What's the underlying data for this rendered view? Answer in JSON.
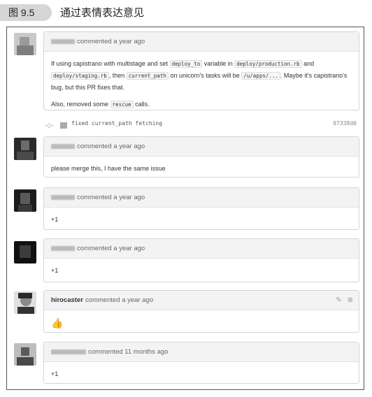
{
  "figure": {
    "number": "图 9.5",
    "title": "通过表情表达意见"
  },
  "comments": [
    {
      "author": "",
      "meta": "commented a year ago",
      "paragraphs": [
        [
          "If using capistrano with multistage and set ",
          "deploy_to",
          " variable in ",
          "deploy/production.rb",
          " and ",
          "deploy/staging.rb",
          ", then ",
          "current_path",
          " on unicorn's tasks will be ",
          "/u/apps/...",
          ". Maybe it's capistrano's bug, but this PR fixes that."
        ],
        [
          "Also, removed some ",
          "rescue",
          " calls."
        ]
      ]
    },
    {
      "author": "",
      "meta": "commented a year ago",
      "text": "please merge this, I have the same issue"
    },
    {
      "author": "",
      "meta": "commented a year ago",
      "text": "+1"
    },
    {
      "author": "",
      "meta": "commented a year ago",
      "text": "+1"
    },
    {
      "author": "hirocaster",
      "meta": "commented a year ago",
      "text": "👍"
    },
    {
      "author": "",
      "meta": "commented 11 months ago",
      "text": "+1"
    }
  ],
  "commit": {
    "message": "fixed current_path fetching",
    "sha": "07338d0"
  },
  "icons": {
    "edit": "pencil-icon",
    "delete": "close-circle-icon",
    "commit": "commit-dot-icon"
  },
  "colors": {
    "header_bg": "#f3f3f3",
    "border": "#d5d5d5"
  }
}
